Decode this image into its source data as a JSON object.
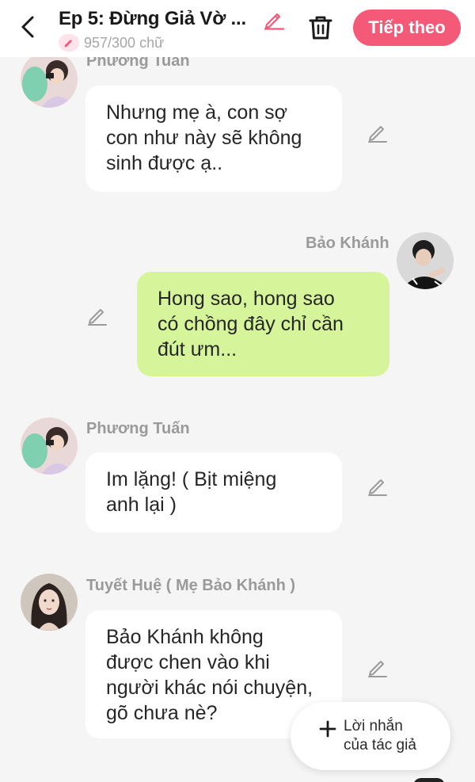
{
  "header": {
    "title": "Ep 5: Đừng Giả Vờ ...",
    "word_count": "957/300 chữ",
    "next_label": "Tiếp theo"
  },
  "messages": [
    {
      "sender": "Phương Tuấn",
      "side": "left",
      "text_lines": [
        "Nhưng mẹ à, con sợ",
        "con như này sẽ không",
        "sinh được ạ.."
      ]
    },
    {
      "sender": "Bảo Khánh",
      "side": "right",
      "text_lines": [
        "Hong sao, hong sao",
        "có chồng đây chỉ cần",
        "đút ưm..."
      ]
    },
    {
      "sender": "Phương Tuấn",
      "side": "left",
      "text_lines": [
        "Im lặng! ( Bịt miệng",
        "anh lại )"
      ]
    },
    {
      "sender": "Tuyết Huệ ( Mẹ Bảo Khánh )",
      "side": "left",
      "text_lines": [
        "Bảo Khánh không",
        "được chen vào khi",
        "người khác nói chuyện,",
        "gõ chưa nè?"
      ]
    }
  ],
  "author_note_button": {
    "line1": "Lời nhắn",
    "line2": "của tác giả"
  },
  "icons": {
    "back": "chevron-left-icon",
    "title_edit": "pencil-icon",
    "word_count_badge": "pencil-icon",
    "delete": "trash-icon",
    "message_edit": "pencil-icon",
    "author_note": "plus-icon"
  },
  "colors": {
    "accent": "#f45a78",
    "background": "#f5f5f5",
    "bubble_other": "#ffffff",
    "bubble_self": "#d6f59a",
    "name_text": "#9a9a9a"
  }
}
